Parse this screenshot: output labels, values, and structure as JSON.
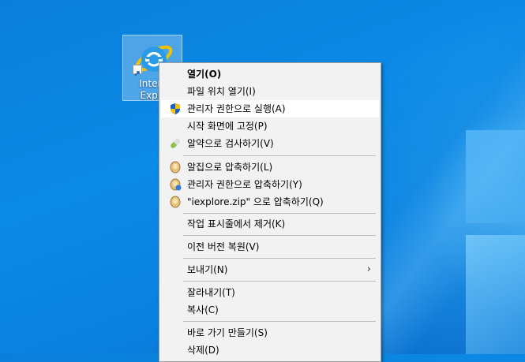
{
  "desktop": {
    "icon_label_line1": "Intern",
    "icon_label_line2": "Explo"
  },
  "context_menu": {
    "items": [
      {
        "label": "열기(O)"
      },
      {
        "label": "파일 위치 열기(I)"
      },
      {
        "label": "관리자 권한으로 실행(A)",
        "icon": "uac-shield-icon"
      },
      {
        "label": "시작 화면에 고정(P)"
      },
      {
        "label": "알약으로 검사하기(V)",
        "icon": "alyac-pill-icon"
      },
      {
        "label": "알집으로 압축하기(L)",
        "icon": "alzip-icon"
      },
      {
        "label": "관리자 권한으로 압축하기(Y)",
        "icon": "alzip-admin-icon"
      },
      {
        "label": "\"iexplore.zip\" 으로 압축하기(Q)",
        "icon": "alzip-icon"
      },
      {
        "label": "작업 표시줄에서 제거(K)"
      },
      {
        "label": "이전 버전 복원(V)"
      },
      {
        "label": "보내기(N)",
        "submenu_arrow": "›"
      },
      {
        "label": "잘라내기(T)"
      },
      {
        "label": "복사(C)"
      },
      {
        "label": "바로 가기 만들기(S)"
      },
      {
        "label": "삭제(D)"
      }
    ]
  },
  "colors": {
    "desktop_blue": "#0a80de",
    "menu_bg": "#f2f2f2",
    "hover_bg": "#ffffff",
    "shield_blue": "#1d5fc5",
    "shield_yellow": "#f4c20d"
  }
}
